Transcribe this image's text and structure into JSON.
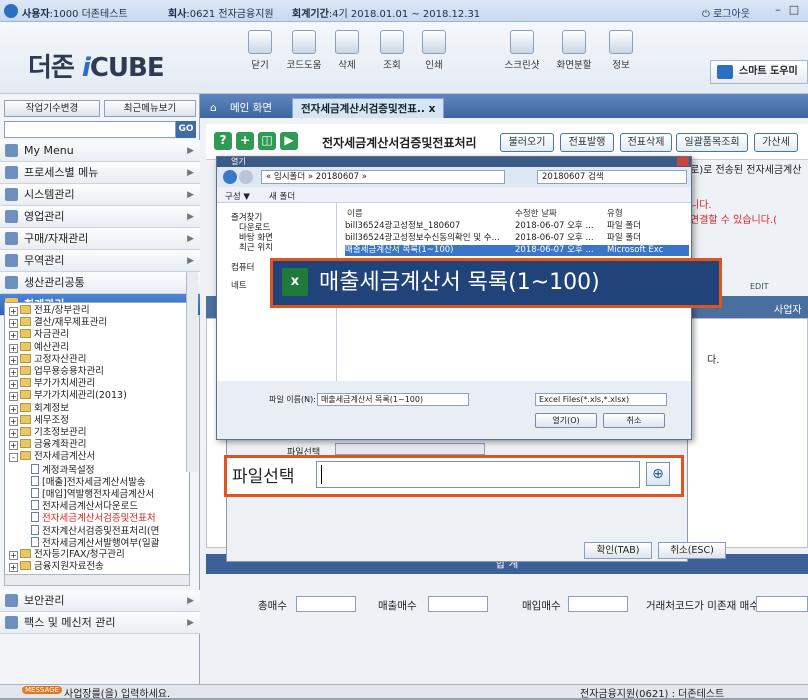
{
  "titlebar": {
    "user_label": "사용자",
    "user_value": ":1000 더존테스트",
    "company_label": "회사",
    "company_value": ":0621 전자금융지원",
    "period_label": "회계기간",
    "period_value": ":4기 2018.01.01 ~ 2018.12.31",
    "logout": "로그아웃"
  },
  "logo": {
    "prefix": "더존",
    "i": "i",
    "suffix": "CUBE"
  },
  "toolbar": [
    "닫기",
    "코드도움",
    "삭제",
    "조회",
    "인쇄",
    "스크린샷",
    "화면분할",
    "정보"
  ],
  "smart_help": "스마트 도우미",
  "sidebar": {
    "btn_change": "작업기수변경",
    "btn_recent": "최근메뉴보기",
    "go": "GO",
    "menus": [
      "My Menu",
      "프로세스별 메뉴",
      "시스템관리",
      "영업관리",
      "구매/자재관리",
      "무역관리",
      "생산관리공통",
      "회계관리"
    ],
    "tree": [
      {
        "t": "전표/장부관리",
        "k": "f"
      },
      {
        "t": "결산/재무제표관리",
        "k": "f"
      },
      {
        "t": "자금관리",
        "k": "f"
      },
      {
        "t": "예산관리",
        "k": "f"
      },
      {
        "t": "고정자산관리",
        "k": "f"
      },
      {
        "t": "업무용승용차관리",
        "k": "f"
      },
      {
        "t": "부가가치세관리",
        "k": "f"
      },
      {
        "t": "부가가치세관리(2013)",
        "k": "f"
      },
      {
        "t": "회계정보",
        "k": "f"
      },
      {
        "t": "세무조정",
        "k": "f"
      },
      {
        "t": "기초정보관리",
        "k": "f"
      },
      {
        "t": "금융계좌관리",
        "k": "f"
      },
      {
        "t": "전자세금계산서",
        "k": "o"
      },
      {
        "t": "계정과목설정",
        "k": "p"
      },
      {
        "t": "[매출]전자세금계산서발송",
        "k": "p"
      },
      {
        "t": "[매입]역발행전자세금계산서",
        "k": "p"
      },
      {
        "t": "전자세금계산서다운로드",
        "k": "p"
      },
      {
        "t": "전자세금계산서검증및전표처",
        "k": "r"
      },
      {
        "t": "전자계산서검증및전표처리(면",
        "k": "p"
      },
      {
        "t": "전자세금계산서발행여부(일괄",
        "k": "p"
      },
      {
        "t": "전자등기FAX/청구관리",
        "k": "f"
      },
      {
        "t": "금융지원자료전송",
        "k": "f"
      }
    ],
    "bottom_menus": [
      "보안관리",
      "팩스 및 메신저 관리"
    ]
  },
  "tabs": {
    "main": "메인 화면",
    "current": "전자세금계산서검증및전표..",
    "close": "x"
  },
  "form": {
    "title": "전자세금계산서검증및전표처리",
    "buttons": [
      "불러오기",
      "전표발행",
      "전표삭제",
      "일괄품목조회",
      "가산세"
    ],
    "msg1": "로)로 전송된 전자세금계산",
    "msg2": "니다.",
    "msg3": "연결할 수 있습니다.(",
    "edit": "EDIT",
    "col_bizno": "사업자번호",
    "col_da": "다."
  },
  "sum_label": "합 계",
  "bottom": {
    "total": "총매수",
    "sales": "매출매수",
    "purchase": "매입매수",
    "no_code": "거래처코드가 미존재 매수"
  },
  "status": {
    "badge": "MESSAGE",
    "message": "사업장를(을) 입력하세요.",
    "company": "전자금융지원(0621) : 더존테스트"
  },
  "dialog1": {
    "title": "열기",
    "address": "« 임시폴더 » 20180607 »",
    "search": "20180607 검색",
    "organize": "구성 ▼",
    "newfolder": "새 폴더",
    "nav": [
      "즐겨찾기",
      "다운로드",
      "바탕 화면",
      "최근 위치",
      "컴퓨터",
      "네트"
    ],
    "cols": [
      "이름",
      "수정한 날짜",
      "유형"
    ],
    "rows": [
      {
        "name": "bill36524광고성정보_180607",
        "date": "2018-06-07 오후 ...",
        "type": "파일 폴더"
      },
      {
        "name": "bill36524광고성정보수신동의확인 및 수...",
        "date": "2018-06-07 오후 ...",
        "type": "파일 폴더"
      },
      {
        "name": "매출세금계산서 목록(1~100)",
        "date": "2018-06-07 오후 ...",
        "type": "Microsoft Exc"
      }
    ],
    "fname_label": "파일 이름(N):",
    "fname": "매출세금계산서 목록(1~100)",
    "ftype": "Excel Files(*.xls,*.xlsx)",
    "open": "열기(O)",
    "cancel": "취소"
  },
  "zoom_title": "매출세금계산서 목록(1~100)",
  "dialog2": {
    "file_label_small": "파일선택",
    "file_label": "파일선택",
    "confirm": "확인(TAB)",
    "cancel": "취소(ESC)"
  }
}
